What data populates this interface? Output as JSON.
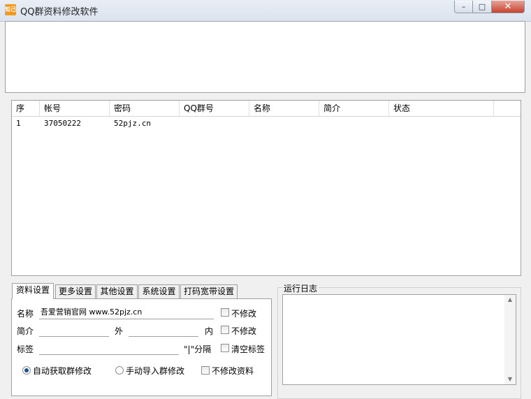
{
  "window": {
    "title": "QQ群资料修改软件",
    "app_icon_text": "知己",
    "minimize_glyph": "–",
    "maximize_glyph": "□",
    "close_glyph": "✕"
  },
  "table": {
    "columns": [
      "序",
      "帐号",
      "密码",
      "QQ群号",
      "名称",
      "简介",
      "状态"
    ],
    "rows": [
      [
        "1",
        "37050222",
        "52pjz.cn",
        "",
        "",
        "",
        ""
      ]
    ]
  },
  "tabs": [
    "资料设置",
    "更多设置",
    "其他设置",
    "系统设置",
    "打码宽带设置"
  ],
  "form": {
    "name_label": "名称",
    "name_value": "吾爱营销官网 www.52pjz.cn",
    "name_nochange_label": "不修改",
    "intro_label": "简介",
    "outer_label": "外",
    "inner_label": "内",
    "intro_outer_value": "",
    "intro_inner_value": "",
    "intro_nochange_label": "不修改",
    "tag_label": "标签",
    "tag_value": "",
    "tag_separator_hint": "\"|\"分隔",
    "clear_tags_label": "清空标签",
    "radio_auto_label": "自动获取群修改",
    "radio_manual_label": "手动导入群修改",
    "no_modify_profile_label": "不修改资料",
    "selected_mode": "auto"
  },
  "log": {
    "label": "运行日志",
    "content": ""
  }
}
